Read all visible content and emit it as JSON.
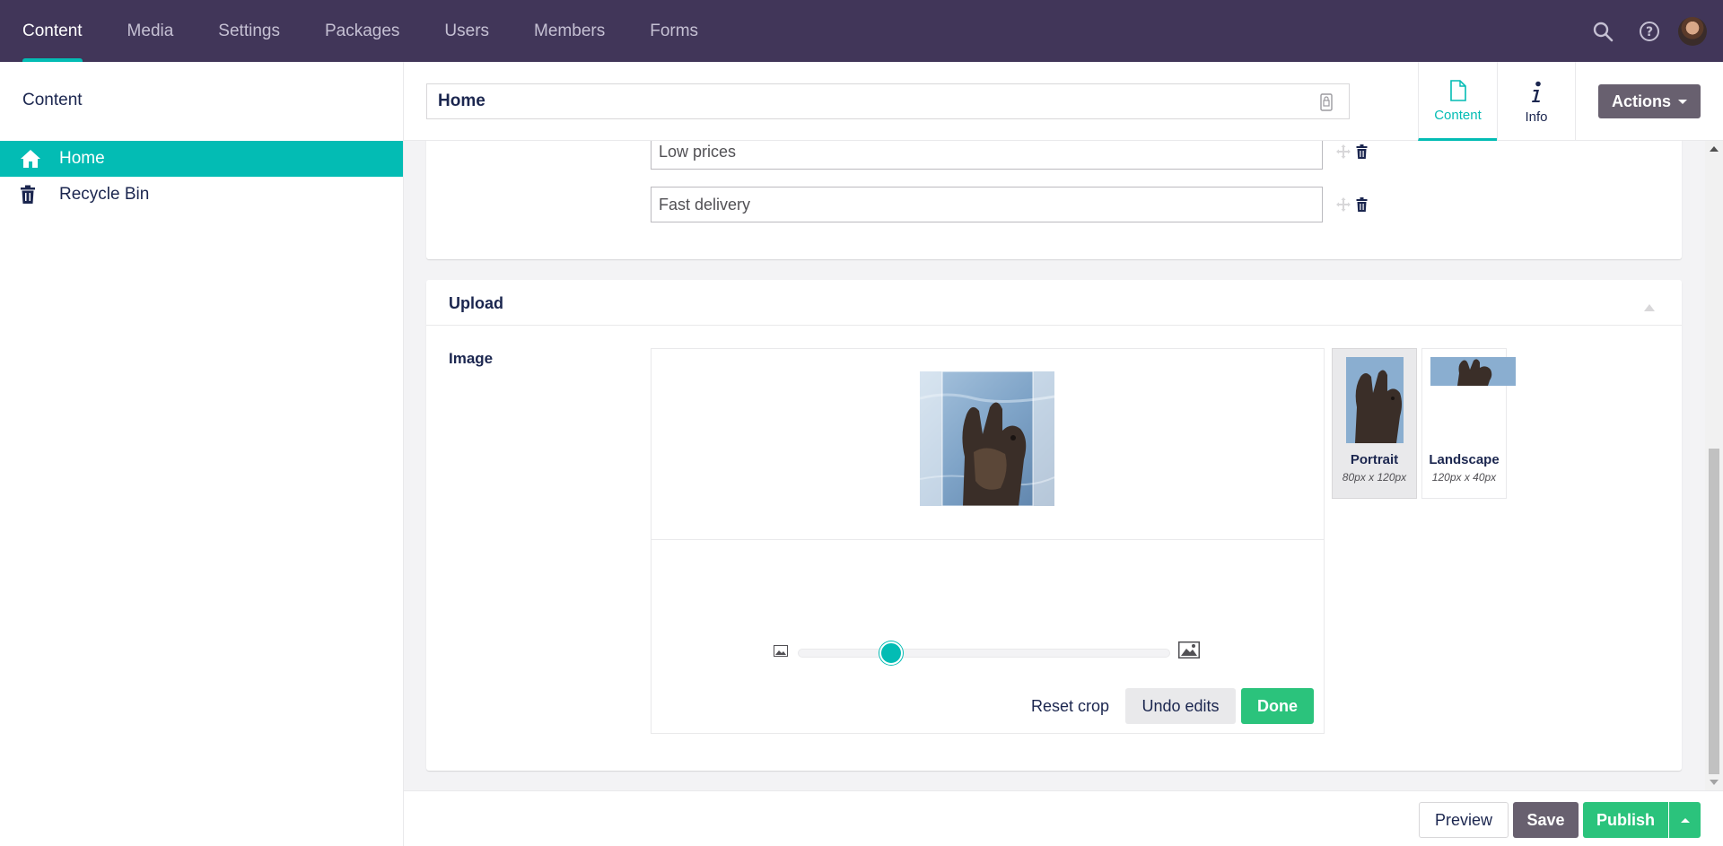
{
  "nav": {
    "items": [
      {
        "label": "Content",
        "active": true
      },
      {
        "label": "Media"
      },
      {
        "label": "Settings"
      },
      {
        "label": "Packages"
      },
      {
        "label": "Users"
      },
      {
        "label": "Members"
      },
      {
        "label": "Forms"
      }
    ],
    "icons": [
      "search-icon",
      "help-icon",
      "avatar"
    ]
  },
  "sidebar": {
    "title": "Content",
    "items": [
      {
        "label": "Home",
        "icon": "home-icon",
        "selected": true
      },
      {
        "label": "Recycle Bin",
        "icon": "trash-icon"
      }
    ]
  },
  "editor": {
    "name_value": "Home",
    "tabs": [
      {
        "label": "Content",
        "icon": "document-icon",
        "active": true
      },
      {
        "label": "Info",
        "icon": "info-icon"
      }
    ],
    "actions_label": "Actions"
  },
  "list_items": [
    "Low prices",
    "Fast delivery"
  ],
  "upload": {
    "group_title": "Upload",
    "property_label": "Image",
    "buttons": {
      "reset": "Reset crop",
      "undo": "Undo edits",
      "done": "Done"
    },
    "zoom_level": 0.25,
    "crops": [
      {
        "name": "Portrait",
        "size": "80px x 120px",
        "active": true
      },
      {
        "name": "Landscape",
        "size": "120px x 40px"
      }
    ]
  },
  "footer": {
    "preview": "Preview",
    "save": "Save",
    "publish": "Publish"
  },
  "colors": {
    "header_bg": "#413659",
    "accent": "#03bcb4",
    "publish": "#2bc37c",
    "save": "#68606f"
  }
}
